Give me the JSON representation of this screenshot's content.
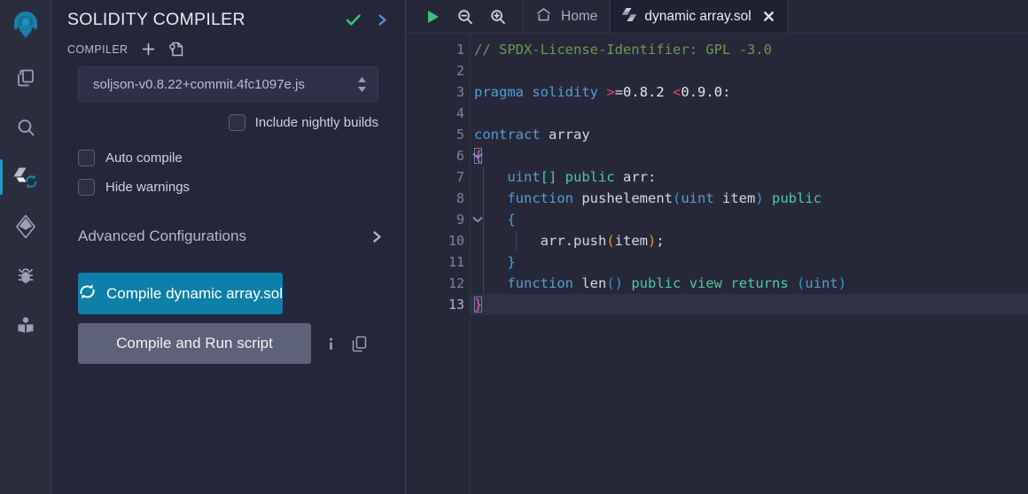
{
  "app": {
    "name": "Remix IDE",
    "logo_icon": "remix-logo"
  },
  "sidebar": {
    "items": [
      {
        "name": "file-explorer",
        "icon": "files-icon",
        "active": false
      },
      {
        "name": "search",
        "icon": "search-icon",
        "active": false
      },
      {
        "name": "solidity-compiler",
        "icon": "solidity-compile-icon",
        "active": true
      },
      {
        "name": "deploy-run",
        "icon": "ethereum-icon",
        "active": false
      },
      {
        "name": "debugger",
        "icon": "bug-icon",
        "active": false
      },
      {
        "name": "plugin-manager",
        "icon": "book-icon",
        "active": false
      }
    ]
  },
  "panel": {
    "title": "SOLIDITY COMPILER",
    "status_icon": "check-icon",
    "expand_icon": "chevron-right-icon",
    "compiler_label": "COMPILER",
    "add_icon": "plus-icon",
    "config_file_icon": "file-config-icon",
    "version_select": {
      "value": "soljson-v0.8.22+commit.4fc1097e.js",
      "arrows_icon": "sort-arrows-icon"
    },
    "checkboxes": [
      {
        "label": "Include nightly builds",
        "checked": false
      },
      {
        "label": "Auto compile",
        "checked": false
      },
      {
        "label": "Hide warnings",
        "checked": false
      }
    ],
    "advanced": {
      "label": "Advanced Configurations",
      "icon": "chevron-right-icon"
    },
    "compile_button": {
      "label": "Compile dynamic array.sol",
      "icon": "sync-icon"
    },
    "run_script_button": {
      "label": "Compile and Run script"
    },
    "info_icon": "info-icon",
    "copy_icon": "copy-icon"
  },
  "editor": {
    "toolbar": [
      {
        "name": "run-button",
        "icon": "play-icon"
      },
      {
        "name": "zoom-out-button",
        "icon": "zoom-out-icon"
      },
      {
        "name": "zoom-in-button",
        "icon": "zoom-in-icon"
      }
    ],
    "tabs": [
      {
        "label": "Home",
        "icon": "home-icon",
        "active": false,
        "closable": false
      },
      {
        "label": "dynamic array.sol",
        "icon": "solidity-icon",
        "active": true,
        "closable": true,
        "close_icon": "close-icon"
      }
    ],
    "active_line": 13,
    "lines": [
      {
        "n": 1,
        "text": "// SPDX-License-Identifier: GPL -3.0"
      },
      {
        "n": 2,
        "text": ""
      },
      {
        "n": 3,
        "text": "pragma solidity >=0.8.2 <0.9.0:"
      },
      {
        "n": 4,
        "text": ""
      },
      {
        "n": 5,
        "text": "contract array"
      },
      {
        "n": 6,
        "text": "{",
        "fold": true
      },
      {
        "n": 7,
        "text": "    uint[] public arr:"
      },
      {
        "n": 8,
        "text": "    function pushelement(uint item) public"
      },
      {
        "n": 9,
        "text": "    {",
        "fold": true
      },
      {
        "n": 10,
        "text": "        arr.push(item);"
      },
      {
        "n": 11,
        "text": "    }"
      },
      {
        "n": 12,
        "text": "    function len() public view returns (uint)"
      },
      {
        "n": 13,
        "text": "}"
      }
    ]
  },
  "colors": {
    "accent": "#0e7fa8",
    "panel_bg": "#24263a",
    "rail_bg": "#2a2d3e",
    "editor_bg": "#262839",
    "active_line": "#2e3148",
    "success": "#35c27a",
    "comment": "#6a9955",
    "keyword": "#569cd6",
    "visibility": "#4ec9a0",
    "operator": "#e2445c"
  }
}
